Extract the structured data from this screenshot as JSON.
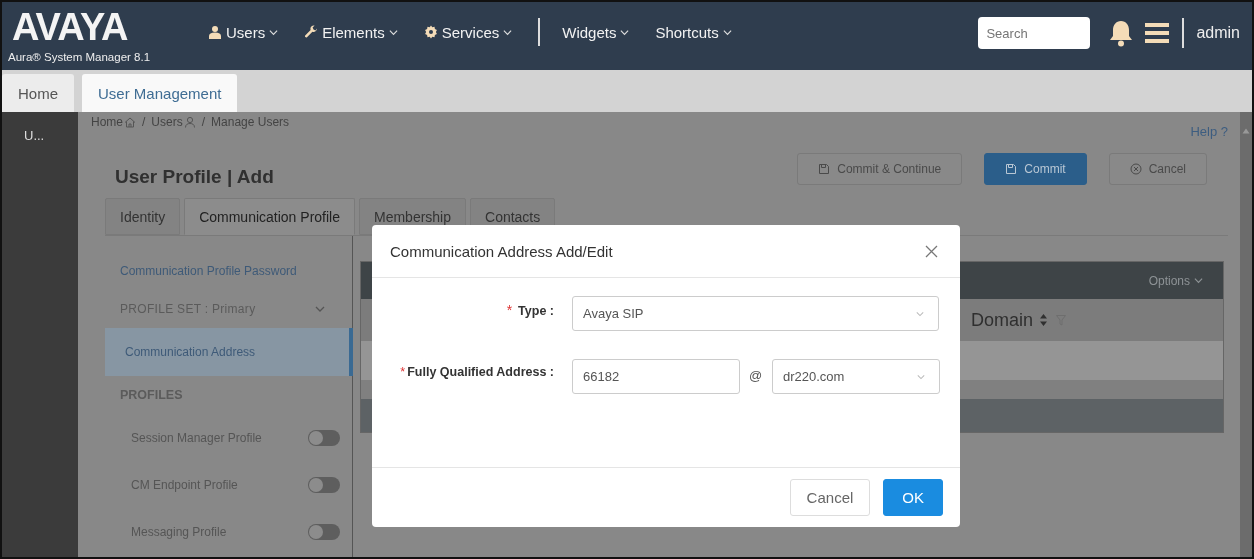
{
  "header": {
    "logo": "AVAYA",
    "product": "Aura® System Manager 8.1",
    "nav_groups": [
      [
        {
          "label": "Users"
        },
        {
          "label": "Elements"
        },
        {
          "label": "Services"
        }
      ],
      [
        {
          "label": "Widgets"
        },
        {
          "label": "Shortcuts"
        }
      ]
    ],
    "search": {
      "placeholder": "Search"
    },
    "user": "admin"
  },
  "tabs": [
    {
      "label": "Home",
      "selected": false
    },
    {
      "label": "User Management",
      "selected": true
    }
  ],
  "sidebar": {
    "label": "U..."
  },
  "breadcrumb": {
    "separator": "/",
    "items": [
      "Home",
      "Users",
      "Manage Users"
    ]
  },
  "help": "Help ?",
  "page": {
    "title": "User Profile | Add",
    "actions": [
      {
        "label": "Commit & Continue",
        "kind": "secondary"
      },
      {
        "label": "Commit",
        "kind": "primary"
      },
      {
        "label": "Cancel",
        "kind": "cancel"
      }
    ],
    "tabs": [
      {
        "label": "Identity",
        "selected": false
      },
      {
        "label": "Communication Profile",
        "selected": true
      },
      {
        "label": "Membership",
        "selected": false
      },
      {
        "label": "Contacts",
        "selected": false
      }
    ],
    "nav": [
      {
        "label": "Communication Profile Password",
        "kind": "link",
        "selected": false
      },
      {
        "label": "PROFILE SET : Primary",
        "kind": "dropdown",
        "selected": false
      },
      {
        "label": "Communication Address",
        "kind": "link",
        "selected": true
      },
      {
        "label": "PROFILES",
        "kind": "heading",
        "selected": false
      }
    ],
    "profiles": [
      {
        "label": "Session Manager Profile",
        "on": false
      },
      {
        "label": "CM Endpoint Profile",
        "on": false
      },
      {
        "label": "Messaging Profile",
        "on": false
      }
    ],
    "table": {
      "menu": "Options",
      "columns": [
        "Domain"
      ]
    }
  },
  "dialog": {
    "title": "Communication Address Add/Edit",
    "fields": [
      {
        "required_mark": "*",
        "label": "Type :",
        "kind": "select",
        "value": "Avaya SIP"
      },
      {
        "required_mark": "*",
        "label": "Fully Qualified Address :",
        "kind": "address",
        "value": "66182",
        "separator": "@",
        "domain": "dr220.com"
      }
    ],
    "buttons": [
      {
        "label": "Cancel",
        "kind": "default"
      },
      {
        "label": "OK",
        "kind": "primary"
      }
    ]
  }
}
